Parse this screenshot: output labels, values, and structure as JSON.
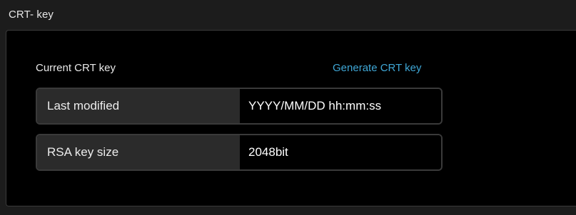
{
  "section": {
    "title": "CRT- key"
  },
  "crt_panel": {
    "label": "Current CRT key",
    "generate_link": "Generate CRT key",
    "rows": [
      {
        "key": "Last modified",
        "value": "YYYY/MM/DD hh:mm:ss"
      },
      {
        "key": "RSA key size",
        "value": "2048bit"
      }
    ]
  },
  "colors": {
    "link": "#3fa7d6",
    "panel_bg": "#000000",
    "page_bg": "#1c1c1c",
    "key_cell_bg": "#2b2b2b",
    "border": "#3a3a3a"
  }
}
